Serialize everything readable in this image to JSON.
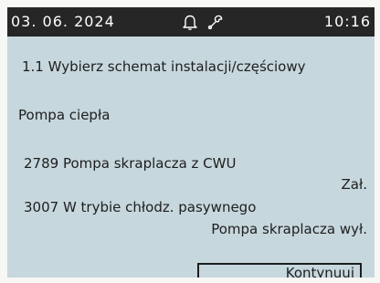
{
  "status_bar": {
    "date": "03. 06. 2024",
    "time": "10:16",
    "icons": [
      "bell-icon",
      "wrench-icon"
    ]
  },
  "screen": {
    "title": "1.1 Wybierz schemat instalacji/częściowy",
    "group_label": "Pompa ciepła",
    "parameters": [
      {
        "name": "2789 Pompa skraplacza z CWU",
        "value": "Zał."
      },
      {
        "name": "3007 W trybie chłodz. pasywnego",
        "value": "Pompa skraplacza wył."
      }
    ],
    "continue_label": "Kontynuuj"
  },
  "colors": {
    "screen_background": "#c6d7dd",
    "status_bar_background": "#262626",
    "text": "#1e1e1e"
  }
}
